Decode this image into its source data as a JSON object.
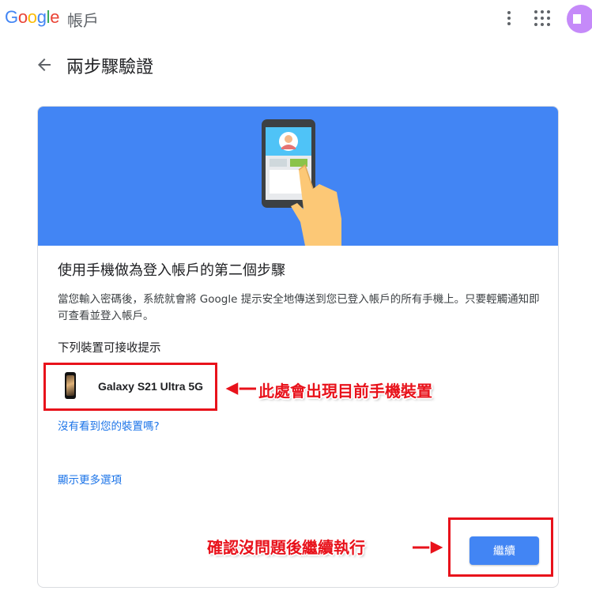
{
  "header": {
    "logo_letters": [
      {
        "ch": "G",
        "color": "#4285F4"
      },
      {
        "ch": "o",
        "color": "#EA4335"
      },
      {
        "ch": "o",
        "color": "#FBBC05"
      },
      {
        "ch": "g",
        "color": "#4285F4"
      },
      {
        "ch": "l",
        "color": "#34A853"
      },
      {
        "ch": "e",
        "color": "#EA4335"
      }
    ],
    "product": "帳戶",
    "icons": [
      "more-vert-icon",
      "apps-grid-icon",
      "avatar"
    ]
  },
  "page": {
    "title": "兩步驟驗證",
    "back_icon": "arrow-left-icon"
  },
  "card": {
    "hero_color": "#4285F4",
    "title": "使用手機做為登入帳戶的第二個步驟",
    "description": "當您輸入密碼後，系統就會將 Google 提示安全地傳送到您已登入帳戶的所有手機上。只要輕觸通知即可查看並登入帳戶。",
    "subhead": "下列裝置可接收提示",
    "device": {
      "icon": "phone-icon",
      "name": "Galaxy S21 Ultra 5G"
    },
    "link_missing_device": "沒有看到您的裝置嗎?",
    "link_more_options": "顯示更多選項",
    "continue_label": "繼續"
  },
  "annotations": {
    "device_note": "此處會出現目前手機裝置",
    "continue_note": "確認沒問題後繼續執行",
    "color": "#E8121B"
  }
}
